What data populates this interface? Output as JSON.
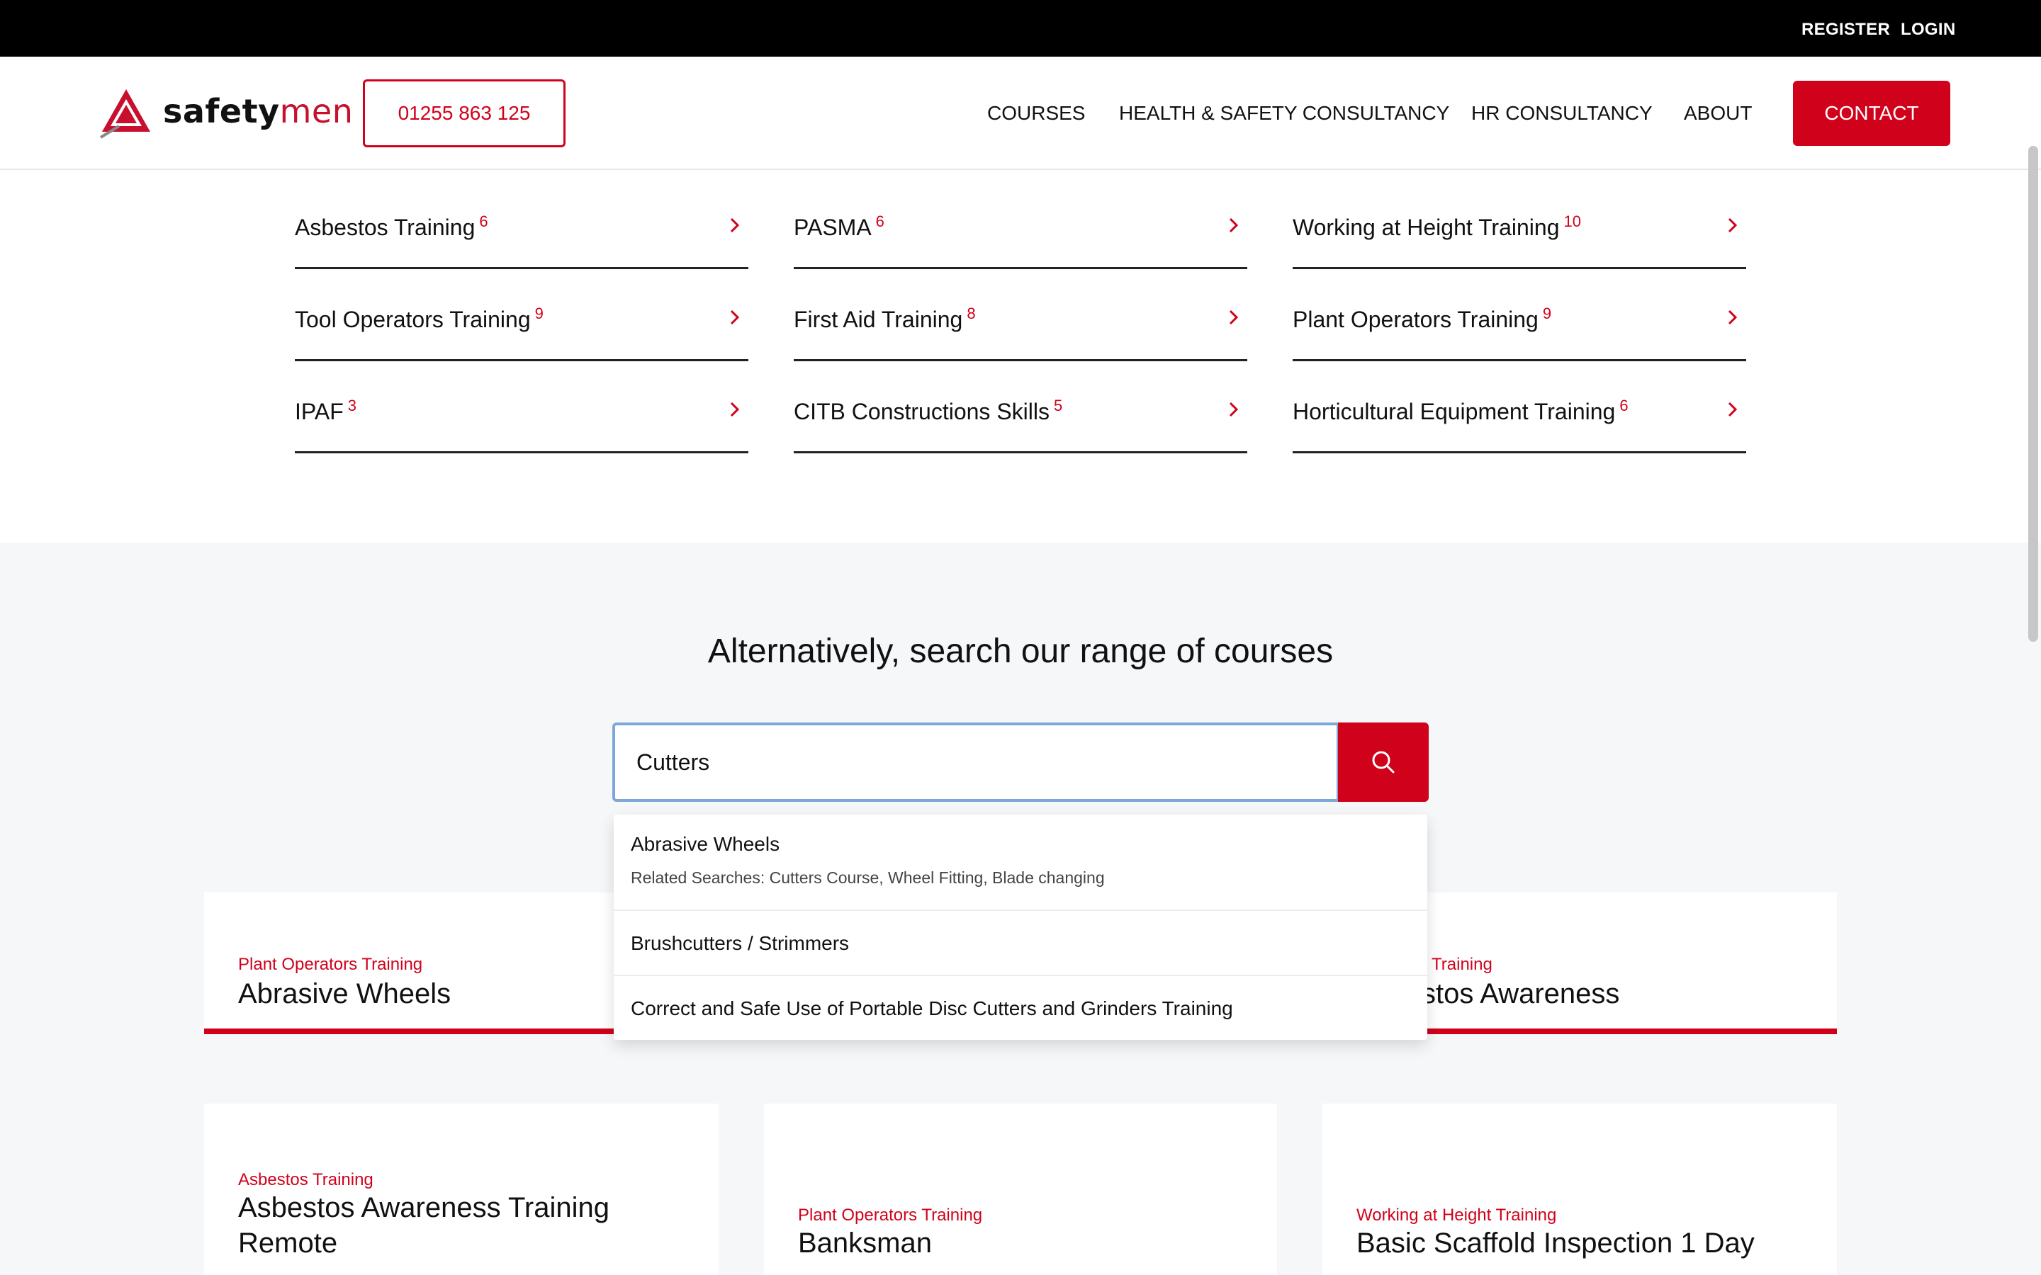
{
  "topbar": {
    "register": "REGISTER",
    "login": "LOGIN"
  },
  "header": {
    "logo_text_a": "safety",
    "logo_text_b": "men",
    "phone": "01255 863 125",
    "nav": [
      "COURSES",
      "HEALTH & SAFETY CONSULTANCY",
      "HR CONSULTANCY",
      "ABOUT"
    ],
    "contact": "CONTACT"
  },
  "categories": [
    {
      "label": "Asbestos Training",
      "count": "6"
    },
    {
      "label": "PASMA",
      "count": "6"
    },
    {
      "label": "Working at Height Training",
      "count": "10"
    },
    {
      "label": "Tool Operators Training",
      "count": "9"
    },
    {
      "label": "First Aid Training",
      "count": "8"
    },
    {
      "label": "Plant Operators Training",
      "count": "9"
    },
    {
      "label": "IPAF",
      "count": "3"
    },
    {
      "label": "CITB Constructions Skills",
      "count": "5"
    },
    {
      "label": "Horticultural Equipment Training",
      "count": "6"
    }
  ],
  "search": {
    "title": "Alternatively, search our range of courses",
    "value": "Cutters"
  },
  "suggestions": [
    {
      "title": "Abrasive Wheels",
      "related": "Related Searches: Cutters Course, Wheel Fitting, Blade changing"
    },
    {
      "title": "Brushcutters / Strimmers"
    },
    {
      "title": "Correct and Safe Use of Portable Disc Cutters and Grinders Training"
    }
  ],
  "cards": [
    {
      "category": "Plant Operators Training",
      "title": "Abrasive Wheels"
    },
    {
      "category": "",
      "title": ""
    },
    {
      "category": "Training",
      "title": "stos Awareness"
    },
    {
      "category": "Asbestos Training",
      "title": "Asbestos Awareness Training Remote"
    },
    {
      "category": "Plant Operators Training",
      "title": "Banksman"
    },
    {
      "category": "Working at Height Training",
      "title": "Basic Scaffold Inspection 1 Day"
    }
  ],
  "colors": {
    "accent": "#d0021b",
    "topbar": "#000000",
    "section_bg": "#f6f7f9"
  }
}
